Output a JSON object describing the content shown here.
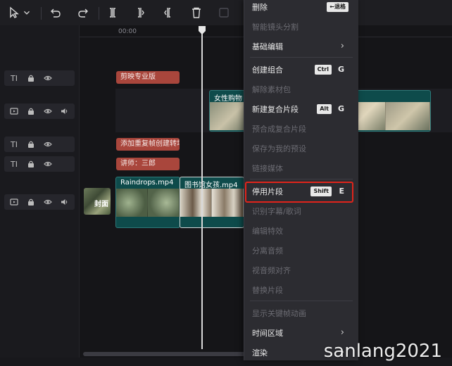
{
  "toolbar": {
    "buttons": [
      "select-tool",
      "dropdown",
      "undo",
      "redo",
      "split",
      "split-left",
      "split-right",
      "delete",
      "freeze"
    ]
  },
  "timeline": {
    "ruler_time": "00:00",
    "text_clips": {
      "title": "剪映专业版",
      "overlay": "添加重复帧创建转场",
      "instructor": "讲师：三郎"
    },
    "video_clips": {
      "upper": "女性购物",
      "main_a": "Raindrops.mp4",
      "main_b": "图书馆女孩.mp4"
    },
    "cover_label": "封面"
  },
  "context_menu": {
    "items": [
      {
        "label": "删除",
        "shortcut": "←退格",
        "enabled": true
      },
      {
        "label": "智能镜头分割",
        "enabled": false
      },
      {
        "label": "基础编辑",
        "submenu": true,
        "enabled": true
      },
      {
        "label": "创建组合",
        "shortcut": "Ctrl",
        "key": "G",
        "enabled": true
      },
      {
        "label": "解除素材包",
        "enabled": false
      },
      {
        "label": "新建复合片段",
        "shortcut": "Alt",
        "key": "G",
        "enabled": true
      },
      {
        "label": "预合成复合片段",
        "enabled": false
      },
      {
        "label": "保存为我的预设",
        "enabled": false
      },
      {
        "label": "链接媒体",
        "enabled": false
      },
      {
        "label": "停用片段",
        "shortcut": "Shift",
        "key": "E",
        "enabled": true,
        "highlighted": true
      },
      {
        "label": "识别字幕/歌词",
        "enabled": false
      },
      {
        "label": "编辑特效",
        "enabled": false
      },
      {
        "label": "分离音频",
        "enabled": false
      },
      {
        "label": "视音频对齐",
        "enabled": false
      },
      {
        "label": "替换片段",
        "enabled": false
      },
      {
        "label": "显示关键帧动画",
        "enabled": false
      },
      {
        "label": "时间区域",
        "submenu": true,
        "enabled": true
      },
      {
        "label": "渲染",
        "submenu": true,
        "enabled": true
      }
    ],
    "submenu_chevron": "›"
  },
  "watermark": "sanlang2021",
  "colors": {
    "text_clip": "#a9463c",
    "video_clip": "#0e4b4b",
    "highlight_border": "#e0241b",
    "menu_bg": "#2c2c31"
  }
}
